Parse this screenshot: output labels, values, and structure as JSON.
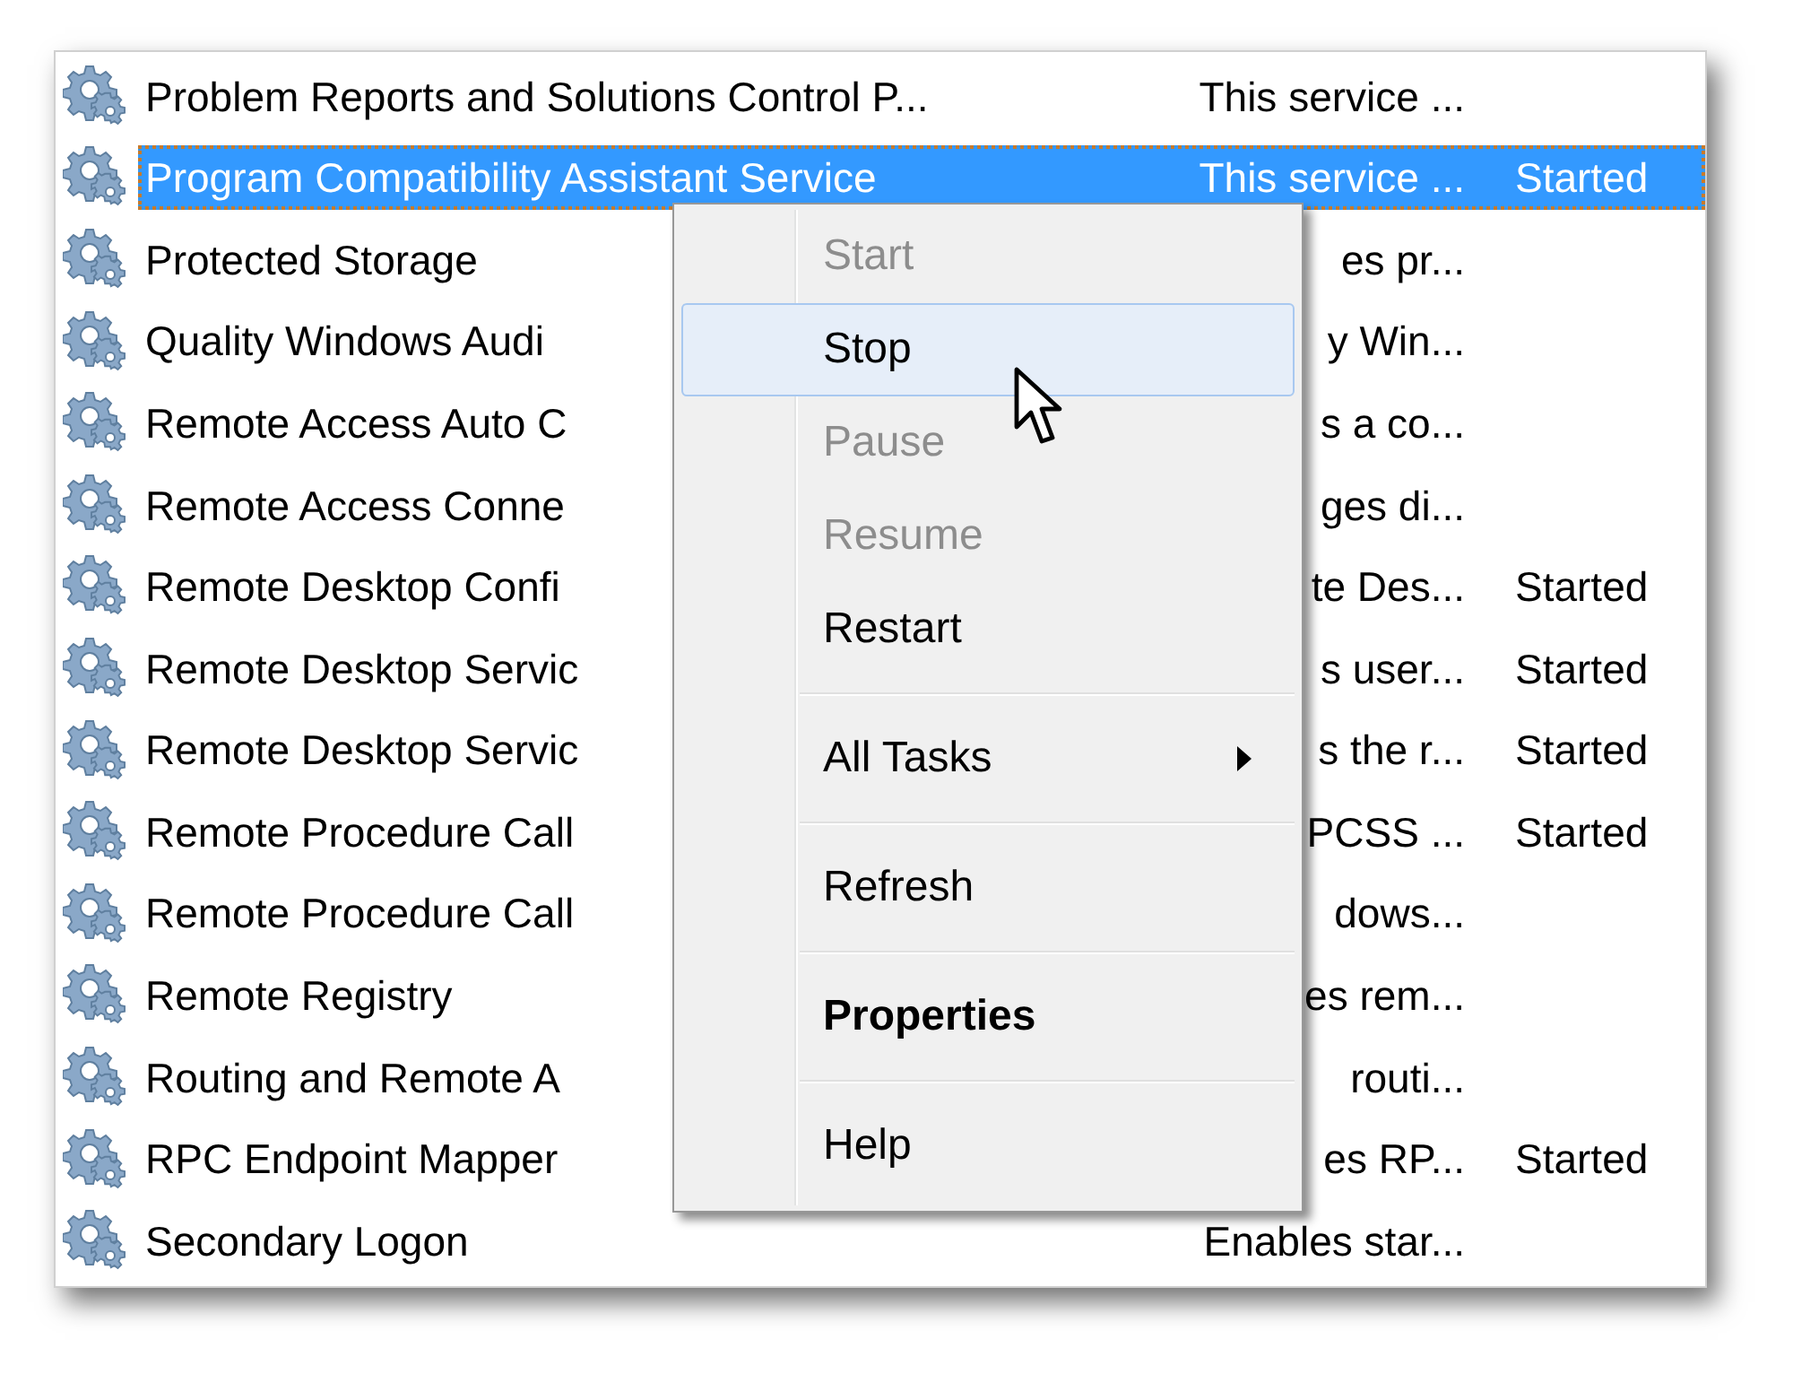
{
  "rows": [
    {
      "name": "Problem Reports and Solutions Control P...",
      "description": "This service ...",
      "selected": false
    },
    {
      "name": "Program Compatibility Assistant Service",
      "description": "This service ...",
      "status": "Started",
      "selected": true
    },
    {
      "name": "Protected Storage",
      "description": "es pr...",
      "selected": false
    },
    {
      "name": "Quality Windows Audi",
      "description": "y Win...",
      "selected": false
    },
    {
      "name": "Remote Access Auto C",
      "description": "s a co...",
      "selected": false
    },
    {
      "name": "Remote Access Conne",
      "description": "ges di...",
      "selected": false
    },
    {
      "name": "Remote Desktop Confi",
      "description": "te Des...",
      "status": "Started",
      "selected": false
    },
    {
      "name": "Remote Desktop Servic",
      "description": "s user...",
      "status": "Started",
      "selected": false
    },
    {
      "name": "Remote Desktop Servic",
      "description": "s the r...",
      "status": "Started",
      "selected": false
    },
    {
      "name": "Remote Procedure Call",
      "description": "PCSS ...",
      "status": "Started",
      "selected": false
    },
    {
      "name": "Remote Procedure Call",
      "description": "dows...",
      "selected": false
    },
    {
      "name": "Remote Registry",
      "description": "es rem...",
      "selected": false
    },
    {
      "name": "Routing and Remote A",
      "description": "routi...",
      "selected": false
    },
    {
      "name": "RPC Endpoint Mapper",
      "description": "es RP...",
      "status": "Started",
      "selected": false
    },
    {
      "name": "Secondary Logon",
      "description": "Enables star...",
      "selected": false
    }
  ],
  "context_menu": {
    "items": [
      {
        "kind": "item",
        "label": "Start",
        "disabled": true,
        "highlighted": false,
        "submenu": false,
        "default": false
      },
      {
        "kind": "item",
        "label": "Stop",
        "disabled": false,
        "highlighted": true,
        "submenu": false,
        "default": false
      },
      {
        "kind": "item",
        "label": "Pause",
        "disabled": true,
        "highlighted": false,
        "submenu": false,
        "default": false
      },
      {
        "kind": "item",
        "label": "Resume",
        "disabled": true,
        "highlighted": false,
        "submenu": false,
        "default": false
      },
      {
        "kind": "item",
        "label": "Restart",
        "disabled": false,
        "highlighted": false,
        "submenu": false,
        "default": false
      },
      {
        "kind": "separator"
      },
      {
        "kind": "item",
        "label": "All Tasks",
        "disabled": false,
        "highlighted": false,
        "submenu": true,
        "default": false
      },
      {
        "kind": "separator"
      },
      {
        "kind": "item",
        "label": "Refresh",
        "disabled": false,
        "highlighted": false,
        "submenu": false,
        "default": false
      },
      {
        "kind": "separator"
      },
      {
        "kind": "item",
        "label": "Properties",
        "disabled": false,
        "highlighted": false,
        "submenu": false,
        "default": true
      },
      {
        "kind": "separator"
      },
      {
        "kind": "item",
        "label": "Help",
        "disabled": false,
        "highlighted": false,
        "submenu": false,
        "default": false
      }
    ]
  }
}
